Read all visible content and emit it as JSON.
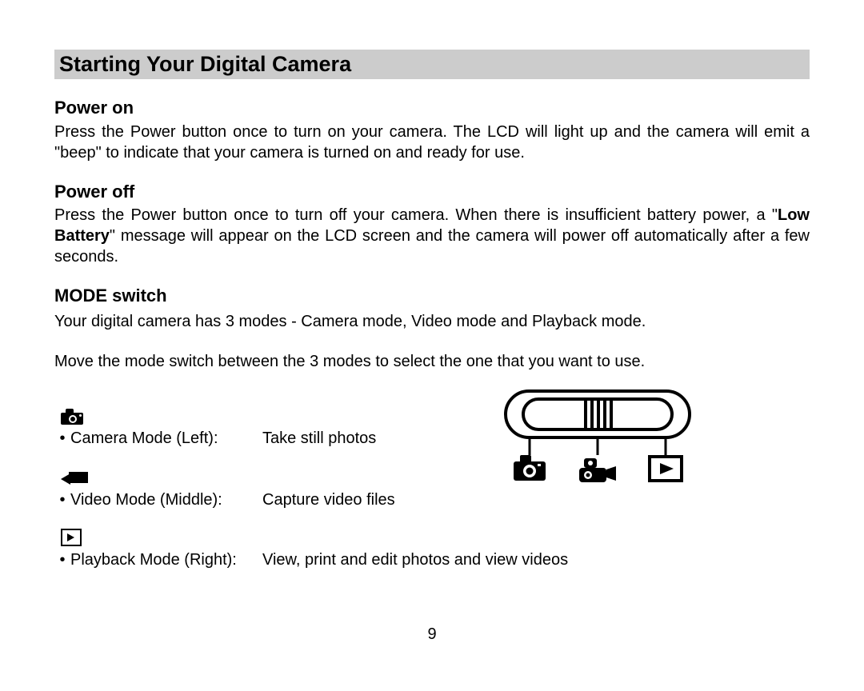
{
  "title": "Starting Your Digital Camera",
  "sections": {
    "power_on": {
      "heading": "Power on",
      "body": "Press the Power button once to turn on your camera. The LCD will light up and the camera will emit a \"beep\" to indicate that your camera is turned on and ready for use."
    },
    "power_off": {
      "heading": "Power off",
      "body_pre": "Press the Power button once to turn off your camera. When there is insufficient battery power, a \"",
      "body_bold": "Low Battery",
      "body_post": "\" message will appear on the LCD screen and the camera will power off automatically after a few seconds."
    },
    "mode_switch": {
      "heading": "MODE switch",
      "line1": "Your digital camera has 3 modes - Camera mode, Video mode and Playback mode.",
      "line2": "Move the mode switch between the 3 modes to select the one that you want to use."
    }
  },
  "modes": {
    "camera": {
      "label": "Camera Mode (Left):",
      "desc": "Take still photos"
    },
    "video": {
      "label": "Video Mode (Middle):",
      "desc": "Capture video files"
    },
    "playback": {
      "label": "Playback Mode (Right):",
      "desc": "View, print and edit photos and view videos"
    }
  },
  "page_number": "9",
  "bullet": "•"
}
